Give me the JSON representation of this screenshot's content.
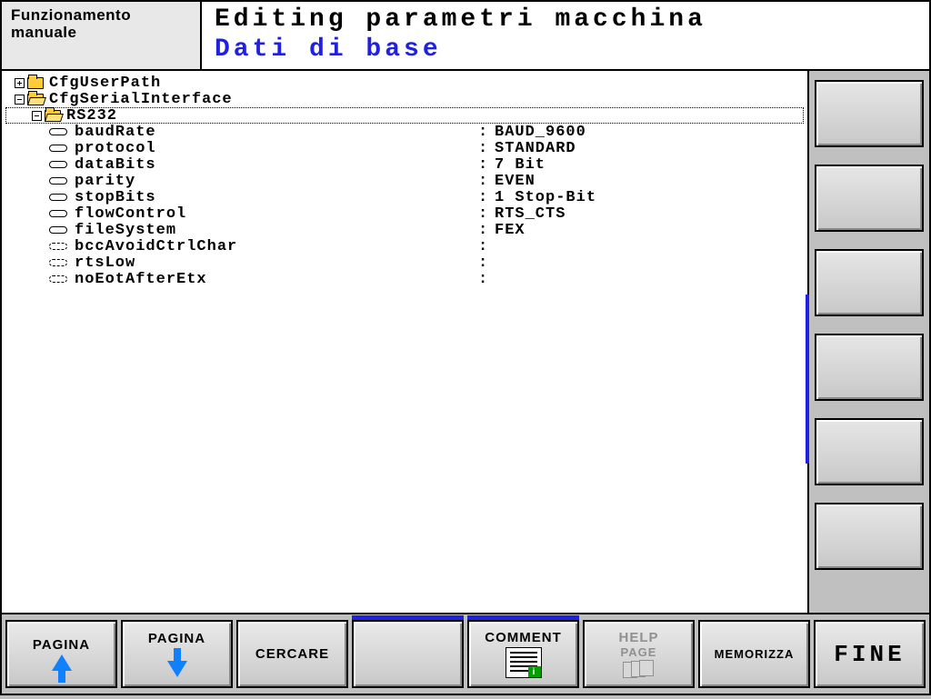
{
  "header": {
    "mode": "Funzionamento\nmanuale",
    "title": "Editing parametri macchina",
    "subtitle": "Dati di base"
  },
  "tree": {
    "nodes": [
      {
        "type": "folder",
        "name": "CfgUserPath",
        "expand": "plus",
        "open": false,
        "indent": 0,
        "selected": false
      },
      {
        "type": "folder",
        "name": "CfgSerialInterface",
        "expand": "minus",
        "open": true,
        "indent": 0,
        "selected": false
      },
      {
        "type": "folder",
        "name": "RS232",
        "expand": "minus",
        "open": true,
        "indent": 1,
        "selected": true
      }
    ],
    "params": [
      {
        "style": "solid",
        "name": "baudRate",
        "value": "BAUD_9600"
      },
      {
        "style": "solid",
        "name": "protocol",
        "value": "STANDARD"
      },
      {
        "style": "solid",
        "name": "dataBits",
        "value": "7 Bit"
      },
      {
        "style": "solid",
        "name": "parity",
        "value": "EVEN"
      },
      {
        "style": "solid",
        "name": "stopBits",
        "value": "1 Stop-Bit"
      },
      {
        "style": "solid",
        "name": "flowControl",
        "value": "RTS_CTS"
      },
      {
        "style": "solid",
        "name": "fileSystem",
        "value": "FEX"
      },
      {
        "style": "dashed",
        "name": "bccAvoidCtrlChar",
        "value": ""
      },
      {
        "style": "dashed",
        "name": "rtsLow",
        "value": ""
      },
      {
        "style": "dashed",
        "name": "noEotAfterEtx",
        "value": ""
      }
    ]
  },
  "softkeys": {
    "page_up": "PAGINA",
    "page_down": "PAGINA",
    "search": "CERCARE",
    "comment": "COMMENT",
    "help1": "HELP",
    "help2": "PAGE",
    "store": "MEMORIZZA",
    "fine": "FINE"
  }
}
